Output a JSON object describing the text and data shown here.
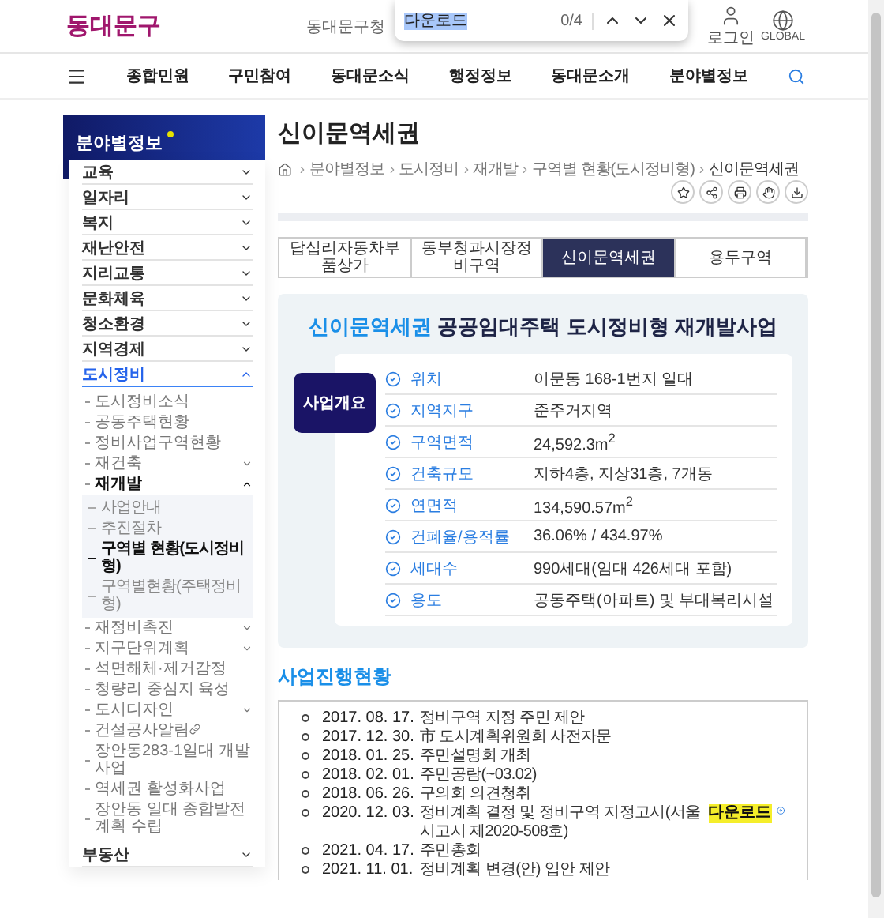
{
  "find_bar": {
    "query": "다운로드",
    "count": "0/4"
  },
  "header": {
    "logo": "동대문구",
    "site_link": "동대문구청",
    "actions": [
      {
        "label": "로그인",
        "kind": "user"
      },
      {
        "label": "GLOBAL",
        "kind": "globe"
      }
    ]
  },
  "nav": {
    "items": [
      "종합민원",
      "구민참여",
      "동대문소식",
      "행정정보",
      "동대문소개",
      "분야별정보"
    ]
  },
  "sidebar": {
    "title": "분야별정보",
    "items": [
      {
        "label": "교육",
        "expanded": false
      },
      {
        "label": "일자리",
        "expanded": false
      },
      {
        "label": "복지",
        "expanded": false
      },
      {
        "label": "재난안전",
        "expanded": false
      },
      {
        "label": "지리교통",
        "expanded": false
      },
      {
        "label": "문화체육",
        "expanded": false
      },
      {
        "label": "청소환경",
        "expanded": false
      },
      {
        "label": "지역경제",
        "expanded": false
      },
      {
        "label": "도시정비",
        "expanded": true,
        "children": [
          {
            "label": "도시정비소식",
            "kind": "link"
          },
          {
            "label": "공동주택현황",
            "kind": "link"
          },
          {
            "label": "정비사업구역현황",
            "kind": "link"
          },
          {
            "label": "재건축",
            "kind": "folder",
            "expanded": false
          },
          {
            "label": "재개발",
            "kind": "folder",
            "expanded": true,
            "children": [
              {
                "label": "사업안내",
                "selected": false
              },
              {
                "label": "추진절차",
                "selected": false
              },
              {
                "label": "구역별 현황(도시정비형)",
                "selected": true
              },
              {
                "label": "구역별현황(주택정비형)",
                "selected": false
              }
            ]
          },
          {
            "label": "재정비촉진",
            "kind": "folder",
            "expanded": false
          },
          {
            "label": "지구단위계획",
            "kind": "folder",
            "expanded": false
          },
          {
            "label": "석면해체·제거감정",
            "kind": "link"
          },
          {
            "label": "청량리 중심지 육성",
            "kind": "link"
          },
          {
            "label": "도시디자인",
            "kind": "folder",
            "expanded": false
          },
          {
            "label": "건설공사알림",
            "kind": "external"
          },
          {
            "label": "장안동283-1일대 개발사업",
            "kind": "link"
          },
          {
            "label": "역세권 활성화사업",
            "kind": "link"
          },
          {
            "label": "장안동 일대 종합발전계획 수립",
            "kind": "link"
          }
        ]
      },
      {
        "label": "부동산",
        "expanded": false
      }
    ]
  },
  "page": {
    "title": "신이문역세권",
    "breadcrumb": [
      "분야별정보",
      "도시정비",
      "재개발",
      "구역별 현황(도시정비형)",
      "신이문역세권"
    ],
    "tabs": [
      {
        "label": "답십리자동차부품상가",
        "selected": false
      },
      {
        "label": "동부청과시장정비구역",
        "selected": false
      },
      {
        "label": "신이문역세권",
        "selected": true
      },
      {
        "label": "용두구역",
        "selected": false
      }
    ]
  },
  "overview": {
    "heading_highlight": "신이문역세권",
    "heading_rest": "공공임대주택 도시정비형 재개발사업",
    "badge": "사업개요",
    "rows": [
      {
        "label": "위치",
        "value": "이문동 168-1번지 일대"
      },
      {
        "label": "지역지구",
        "value": "준주거지역"
      },
      {
        "label": "구역면적",
        "value": "24,592.3m$^{2}$"
      },
      {
        "label": "건축규모",
        "value": "지하4층, 지상31층, 7개동"
      },
      {
        "label": "연면적",
        "value": "134,590.57m$^{2}$"
      },
      {
        "label": "건폐율/용적률",
        "value": "36.06% / 434.97%"
      },
      {
        "label": "세대수",
        "value": "990세대(임대 426세대 포함)"
      },
      {
        "label": "용도",
        "value": "공동주택(아파트) 및 부대복리시설"
      }
    ]
  },
  "progress": {
    "title": "사업진행현황",
    "items": [
      {
        "date": "2017. 08. 17.",
        "text": "정비구역 지정 주민 제안"
      },
      {
        "date": "2017. 12. 30.",
        "text": "市 도시계획위원회 사전자문"
      },
      {
        "date": "2018. 01. 25.",
        "text": "주민설명회 개최"
      },
      {
        "date": "2018. 02. 01.",
        "text": "주민공람(~03.02)"
      },
      {
        "date": "2018. 06. 26.",
        "text": "구의회 의견청취"
      },
      {
        "date": "2020. 12. 03.",
        "text": "정비계획 결정 및 정비구역 지정고시(서울시고시 제2020-508호)",
        "download": "다운로드"
      },
      {
        "date": "2021. 04. 17.",
        "text": "주민총회"
      },
      {
        "date": "2021. 11. 01.",
        "text": "정비계획 변경(안) 입안 제안"
      }
    ]
  }
}
